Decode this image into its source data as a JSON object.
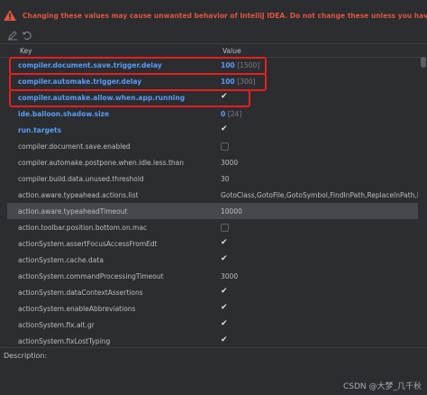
{
  "warning": {
    "text": "Changing these values may cause unwanted behavior of IntelliJ IDEA. Do not change these unless you have been asked to",
    "color": "#e0553d"
  },
  "toolbar": {
    "icons": [
      "edit-icon",
      "restore-icon"
    ]
  },
  "table": {
    "headers": {
      "key": "Key",
      "value": "Value"
    },
    "rows": [
      {
        "key": "compiler.document.save.trigger.delay",
        "value": "100",
        "default": "[1500]",
        "modified": true,
        "type": "text",
        "highlighted": true
      },
      {
        "key": "compiler.automake.trigger.delay",
        "value": "100",
        "default": "[300]",
        "modified": true,
        "type": "text",
        "highlighted": true
      },
      {
        "key": "compiler.automake.allow.when.app.running",
        "value": "",
        "default": "",
        "modified": true,
        "type": "checkbox",
        "checked": true,
        "highlighted": true
      },
      {
        "key": "ide.balloon.shadow.size",
        "value": "0",
        "default": "[24]",
        "modified": true,
        "type": "text"
      },
      {
        "key": "run.targets",
        "value": "",
        "default": "",
        "modified": true,
        "type": "checkbox",
        "checked": true
      },
      {
        "key": "compiler.document.save.enabled",
        "value": "",
        "default": "",
        "modified": false,
        "type": "checkbox",
        "checked": false
      },
      {
        "key": "compiler.automake.postpone.when.idle.less.than",
        "value": "3000",
        "default": "",
        "modified": false,
        "type": "text"
      },
      {
        "key": "compiler.build.data.unused.threshold",
        "value": "30",
        "default": "",
        "modified": false,
        "type": "text"
      },
      {
        "key": "action.aware.typeahead.actions.list",
        "value": "GotoClass,GotoFile,GotoSymbol,FindInPath,ReplaceInPath,FileS",
        "default": "",
        "modified": false,
        "type": "text"
      },
      {
        "key": "action.aware.typeaheadTimeout",
        "value": "10000",
        "default": "",
        "modified": false,
        "type": "text",
        "selected": true
      },
      {
        "key": "action.toolbar.position.bottom.on.mac",
        "value": "",
        "default": "",
        "modified": false,
        "type": "checkbox",
        "checked": false
      },
      {
        "key": "actionSystem.assertFocusAccessFromEdt",
        "value": "",
        "default": "",
        "modified": false,
        "type": "checkbox",
        "checked": true
      },
      {
        "key": "actionSystem.cache.data",
        "value": "",
        "default": "",
        "modified": false,
        "type": "checkbox",
        "checked": true
      },
      {
        "key": "actionSystem.commandProcessingTimeout",
        "value": "3000",
        "default": "",
        "modified": false,
        "type": "text"
      },
      {
        "key": "actionSystem.dataContextAssertions",
        "value": "",
        "default": "",
        "modified": false,
        "type": "checkbox",
        "checked": true
      },
      {
        "key": "actionSystem.enableAbbreviations",
        "value": "",
        "default": "",
        "modified": false,
        "type": "checkbox",
        "checked": true
      },
      {
        "key": "actionSystem.fix.alt.gr",
        "value": "",
        "default": "",
        "modified": false,
        "type": "checkbox",
        "checked": true
      },
      {
        "key": "actionSystem.fixLostTyping",
        "value": "",
        "default": "",
        "modified": false,
        "type": "checkbox",
        "checked": true
      }
    ]
  },
  "description": {
    "label": "Description:"
  },
  "watermark": "CSDN @大梦_几千秋",
  "colors": {
    "modified": "#589df6",
    "highlight": "#e81e1e",
    "selected": "#45484c"
  }
}
